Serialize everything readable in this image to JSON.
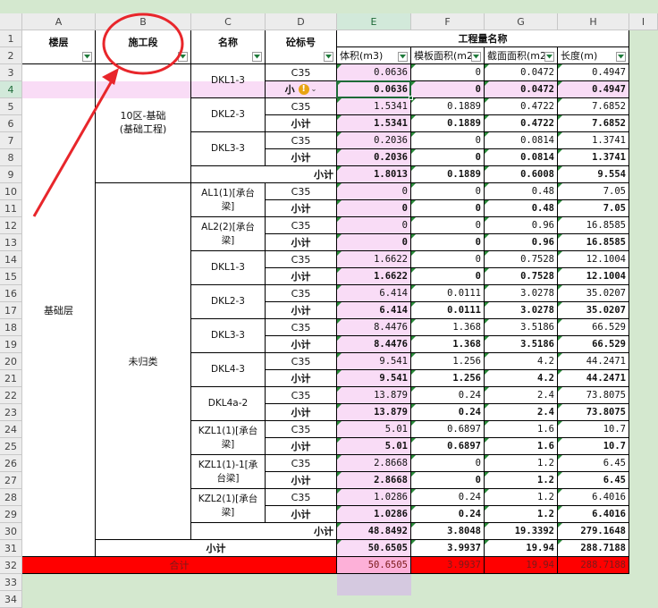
{
  "columns": [
    "A",
    "B",
    "C",
    "D",
    "E",
    "F",
    "G",
    "H",
    "I"
  ],
  "rows": [
    "1",
    "2",
    "3",
    "4",
    "5",
    "6",
    "7",
    "8",
    "9",
    "10",
    "11",
    "12",
    "13",
    "14",
    "15",
    "16",
    "17",
    "18",
    "19",
    "20",
    "21",
    "22",
    "23",
    "24",
    "25",
    "26",
    "27",
    "28",
    "29",
    "30",
    "31",
    "32",
    "33",
    "34"
  ],
  "headers": {
    "floor": "楼层",
    "section": "施工段",
    "name": "名称",
    "concrete_grade": "砼标号",
    "quantity_group": "工程量名称",
    "volume": "体积(m3)",
    "formwork": "模板面积(m2",
    "section_area": "截面面积(m2",
    "length": "长度(m)"
  },
  "floor_value": "基础层",
  "sections": [
    "10区-基础\n(基础工程)",
    "未归类"
  ],
  "members": {
    "dkl1": "DKL1-3",
    "dkl2": "DKL2-3",
    "dkl3": "DKL3-3",
    "al1": "AL1(1)[承台梁]",
    "al2": "AL2(2)[承台梁]",
    "dkl4": "DKL4-3",
    "dkl4a": "DKL4a-2",
    "kzl1": "KZL1(1)[承台梁]",
    "kzl11": "KZL1(1)-1[承台梁]",
    "kzl2": "KZL2(1)[承台梁]"
  },
  "labels": {
    "c35": "C35",
    "subtotal": "小计",
    "subtotal_short": "小",
    "total": "合计",
    "warn": "!",
    "chevron": "⌄"
  },
  "values": {
    "r3": [
      "0.0636",
      "0",
      "0.0472",
      "0.4947"
    ],
    "r4": [
      "0.0636",
      "0",
      "0.0472",
      "0.4947"
    ],
    "r5": [
      "1.5341",
      "0.1889",
      "0.4722",
      "7.6852"
    ],
    "r6": [
      "1.5341",
      "0.1889",
      "0.4722",
      "7.6852"
    ],
    "r7": [
      "0.2036",
      "0",
      "0.0814",
      "1.3741"
    ],
    "r8": [
      "0.2036",
      "0",
      "0.0814",
      "1.3741"
    ],
    "r9": [
      "1.8013",
      "0.1889",
      "0.6008",
      "9.554"
    ],
    "r10": [
      "0",
      "0",
      "0.48",
      "7.05"
    ],
    "r11": [
      "0",
      "0",
      "0.48",
      "7.05"
    ],
    "r12": [
      "0",
      "0",
      "0.96",
      "16.8585"
    ],
    "r13": [
      "0",
      "0",
      "0.96",
      "16.8585"
    ],
    "r14": [
      "1.6622",
      "0",
      "0.7528",
      "12.1004"
    ],
    "r15": [
      "1.6622",
      "0",
      "0.7528",
      "12.1004"
    ],
    "r16": [
      "6.414",
      "0.0111",
      "3.0278",
      "35.0207"
    ],
    "r17": [
      "6.414",
      "0.0111",
      "3.0278",
      "35.0207"
    ],
    "r18": [
      "8.4476",
      "1.368",
      "3.5186",
      "66.529"
    ],
    "r19": [
      "8.4476",
      "1.368",
      "3.5186",
      "66.529"
    ],
    "r20": [
      "9.541",
      "1.256",
      "4.2",
      "44.2471"
    ],
    "r21": [
      "9.541",
      "1.256",
      "4.2",
      "44.2471"
    ],
    "r22": [
      "13.879",
      "0.24",
      "2.4",
      "73.8075"
    ],
    "r23": [
      "13.879",
      "0.24",
      "2.4",
      "73.8075"
    ],
    "r24": [
      "5.01",
      "0.6897",
      "1.6",
      "10.7"
    ],
    "r25": [
      "5.01",
      "0.6897",
      "1.6",
      "10.7"
    ],
    "r26": [
      "2.8668",
      "0",
      "1.2",
      "6.45"
    ],
    "r27": [
      "2.8668",
      "0",
      "1.2",
      "6.45"
    ],
    "r28": [
      "1.0286",
      "0.24",
      "1.2",
      "6.4016"
    ],
    "r29": [
      "1.0286",
      "0.24",
      "1.2",
      "6.4016"
    ],
    "r30": [
      "48.8492",
      "3.8048",
      "19.3392",
      "279.1648"
    ],
    "r31": [
      "50.6505",
      "3.9937",
      "19.94",
      "288.7188"
    ],
    "r32": [
      "50.6505",
      "3.9937",
      "19.94",
      "288.7188"
    ]
  },
  "colors": {
    "pink": "#f9dcf6",
    "total_red": "#ff0000",
    "annotation_red": "#e8262b",
    "sheet_green": "#d4e8cf"
  }
}
